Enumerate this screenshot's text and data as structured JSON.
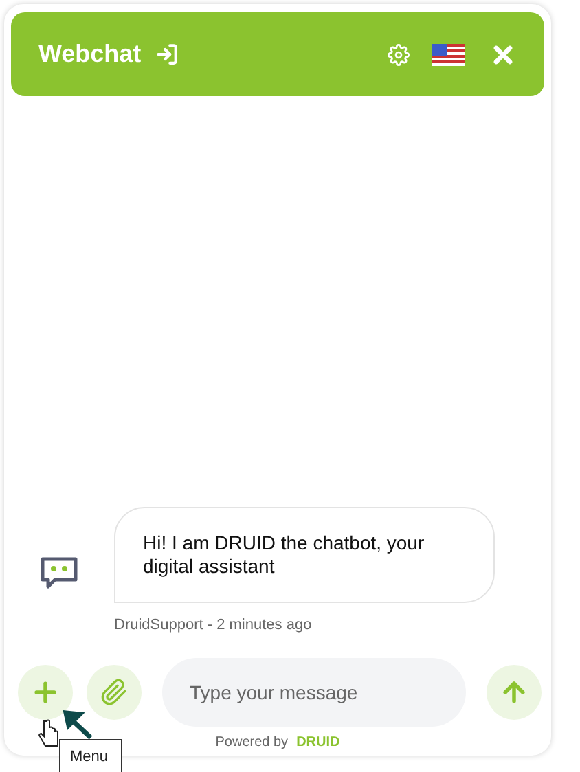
{
  "header": {
    "title": "Webchat"
  },
  "messages": [
    {
      "text": "Hi! I am DRUID the chatbot, your digital assistant",
      "meta": "DruidSupport - 2 minutes ago"
    }
  ],
  "composer": {
    "placeholder": "Type your message"
  },
  "footer": {
    "prefix": "Powered by",
    "brand": "DRUID"
  },
  "tooltip": {
    "text": "Menu"
  }
}
